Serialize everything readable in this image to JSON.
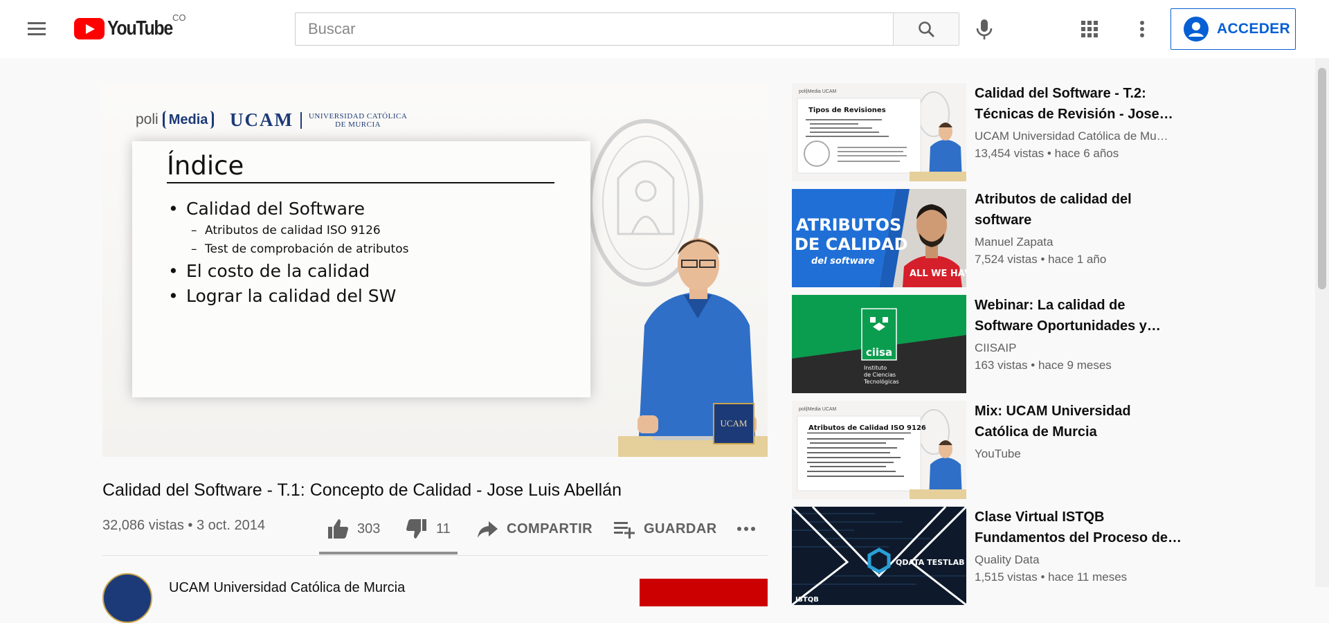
{
  "header": {
    "logo_text": "YouTube",
    "country_code": "CO",
    "search_placeholder": "Buscar",
    "signin_label": "ACCEDER",
    "accent_color": "#065fd4",
    "brand_color": "#ff0000",
    "icons": [
      "menu-icon",
      "youtube-logo",
      "search-icon",
      "mic-icon",
      "apps-icon",
      "more-vert-icon",
      "account-icon"
    ]
  },
  "player": {
    "slide": {
      "org_logo": "poli",
      "org_logo_bracket": "Media",
      "university_short": "UCAM",
      "university_long_line1": "UNIVERSIDAD CATÓLICA",
      "university_long_line2": "DE MURCIA",
      "title": "Índice",
      "bullets": [
        {
          "text": "Calidad del Software",
          "level": 1
        },
        {
          "text": "Atributos de calidad ISO 9126",
          "level": 2
        },
        {
          "text": "Test de comprobación de atributos",
          "level": 2
        },
        {
          "text": "El costo de la calidad",
          "level": 1
        },
        {
          "text": "Lograr la calidad del SW",
          "level": 1
        }
      ],
      "corner_badge": "UCAM"
    }
  },
  "video": {
    "title": "Calidad del Software - T.1: Concepto de Calidad - Jose Luis Abellán",
    "views": "32,086 vistas",
    "date": "3 oct. 2014",
    "stats_separator": "•",
    "likes": "303",
    "dislikes": "11",
    "share_label": "COMPARTIR",
    "save_label": "GUARDAR",
    "like_ratio": 0.965,
    "channel_name": "UCAM Universidad Católica de Murcia"
  },
  "recommendations": [
    {
      "title": "Calidad del Software - T.2: Técnicas de Revisión - Jose…",
      "channel": "UCAM Universidad Católica de Mu…",
      "views": "13,454 vistas",
      "age": "hace 6 años",
      "thumb_kind": "slide-presenter",
      "thumb_title": "Tipos de Revisiones"
    },
    {
      "title": "Atributos de calidad del software",
      "channel": "Manuel Zapata",
      "views": "7,524 vistas",
      "age": "hace 1 año",
      "thumb_kind": "text-banner",
      "thumb_line1": "ATRIBUTOS",
      "thumb_line2": "DE CALIDAD",
      "thumb_line3": "del software",
      "thumb_shirt": "ALL WE HAVE"
    },
    {
      "title": "Webinar: La calidad de Software Oportunidades y…",
      "channel": "CIISAIP",
      "views": "163 vistas",
      "age": "hace 9 meses",
      "thumb_kind": "logo",
      "thumb_brand": "ciisa",
      "thumb_sub1": "Instituto",
      "thumb_sub2": "de Ciencias",
      "thumb_sub3": "Tecnológicas"
    },
    {
      "title": "Mix: UCAM Universidad Católica de Murcia",
      "channel": "YouTube",
      "views": "",
      "age": "",
      "thumb_kind": "slide-presenter",
      "thumb_title": "Atributos de Calidad ISO 9126"
    },
    {
      "title": "Clase Virtual ISTQB Fundamentos del Proceso de…",
      "channel": "Quality Data",
      "views": "1,515 vistas",
      "age": "hace 11 meses",
      "thumb_kind": "tech",
      "thumb_brand": "QDATA TESTLAB",
      "thumb_tag": "ISTQB"
    }
  ],
  "meta_separator": "•"
}
